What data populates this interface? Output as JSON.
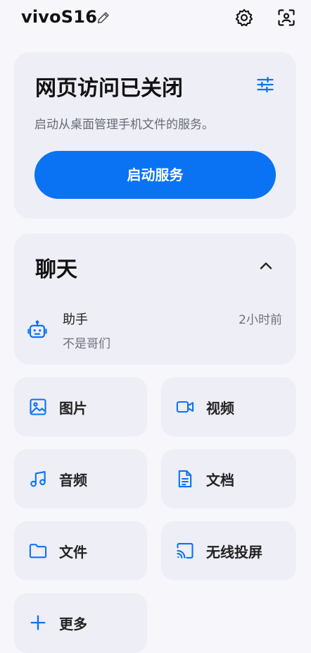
{
  "header": {
    "device_name": "vivoS16",
    "icons": [
      "edit-icon",
      "gear-icon",
      "scan-icon"
    ]
  },
  "web_access": {
    "title": "网页访问已关闭",
    "description": "启动从桌面管理手机文件的服务。",
    "start_button": "启动服务",
    "icon": "tune-icon"
  },
  "chat": {
    "title": "聊天",
    "item": {
      "name": "助手",
      "preview": "不是哥们",
      "time": "2小时前",
      "icon": "robot-icon"
    }
  },
  "tiles": [
    {
      "label": "图片",
      "icon": "image-icon"
    },
    {
      "label": "视频",
      "icon": "video-icon"
    },
    {
      "label": "音频",
      "icon": "music-icon"
    },
    {
      "label": "文档",
      "icon": "document-icon"
    },
    {
      "label": "文件",
      "icon": "folder-icon"
    },
    {
      "label": "无线投屏",
      "icon": "cast-icon"
    },
    {
      "label": "更多",
      "icon": "plus-icon"
    }
  ],
  "colors": {
    "accent": "#0a73f4",
    "card": "#eeeef6",
    "background": "#f7f7fb"
  }
}
